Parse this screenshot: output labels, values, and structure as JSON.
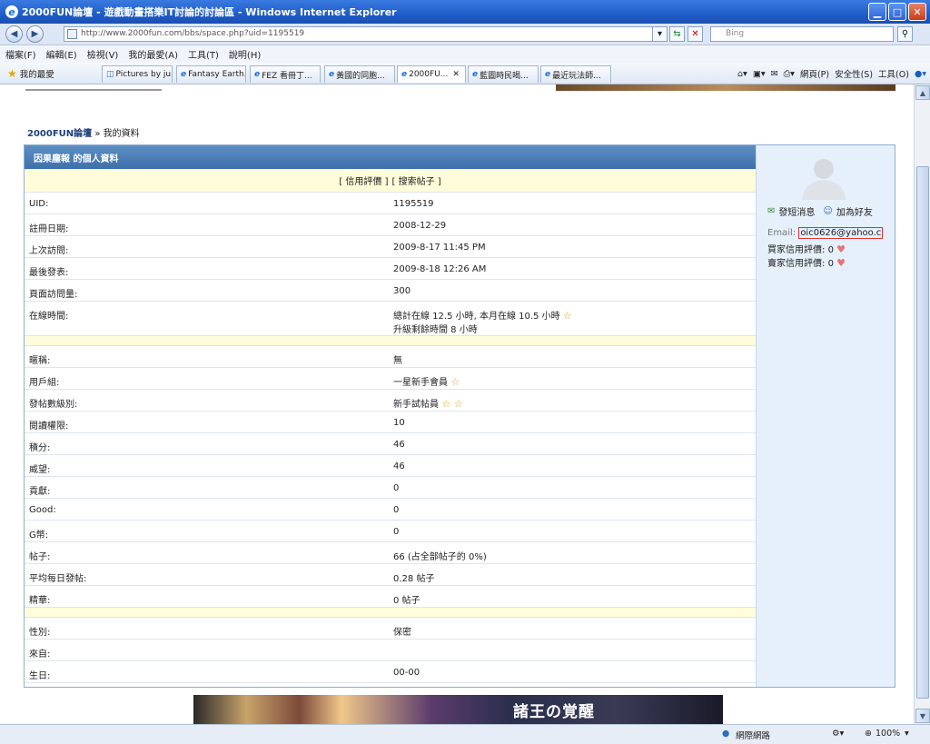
{
  "window": {
    "title": "2000FUN論壇 - 遊戲動畫搭樂IT討論的討論區 - Windows Internet Explorer"
  },
  "address": {
    "url": "http://www.2000fun.com/bbs/space.php?uid=1195519",
    "search_placeholder": "Bing"
  },
  "menu": [
    "檔案(F)",
    "編輯(E)",
    "檢視(V)",
    "我的最愛(A)",
    "工具(T)",
    "說明(H)"
  ],
  "favorites": {
    "label": "我的最愛"
  },
  "tabs": [
    "Pictures by ju...",
    "Fantasy Earth...",
    "FEZ 看冊丁...",
    "黃國的同胞...",
    "2000FU...",
    "藍圖時民喝...",
    "最近玩法師..."
  ],
  "cmd": {
    "page": "網頁(P)",
    "safety": "安全性(S)",
    "tools": "工具(O)"
  },
  "breadcrumb": {
    "site": "2000FUN論壇",
    "sep": "»",
    "page": "我的資料"
  },
  "panel": {
    "title": "因果塵報 的個人資料",
    "links": [
      "[ 信用評價 ]",
      "[ 搜索帖子 ]"
    ],
    "rows1": [
      {
        "k": "UID:",
        "v": "1195519"
      },
      {
        "k": "註冊日期:",
        "v": "2008-12-29"
      },
      {
        "k": "上次訪問:",
        "v": "2009-8-17 11:45 PM"
      },
      {
        "k": "最後發表:",
        "v": "2009-8-18 12:26 AM"
      },
      {
        "k": "頁面訪問量:",
        "v": "300"
      }
    ],
    "online": {
      "k": "在線時間:",
      "v1": "總計在線 12.5 小時, 本月在線 10.5 小時",
      "v2": "升級剩餘時間 8 小時"
    },
    "rows2": [
      {
        "k": "暱稱:",
        "v": "無"
      },
      {
        "k": "用戶組:",
        "v": "一星新手會員"
      },
      {
        "k": "發帖數級別:",
        "v": "新手試帖員"
      },
      {
        "k": "閱讀權限:",
        "v": "10"
      },
      {
        "k": "積分:",
        "v": "46"
      },
      {
        "k": "威望:",
        "v": "46"
      },
      {
        "k": "貢獻:",
        "v": "0"
      },
      {
        "k": "Good:",
        "v": "0"
      },
      {
        "k": "G幣:",
        "v": "0"
      },
      {
        "k": "帖子:",
        "v": "66 (占全部帖子的 0%)"
      },
      {
        "k": "平均每日發帖:",
        "v": "0.28 帖子"
      },
      {
        "k": "精華:",
        "v": "0 帖子"
      }
    ],
    "rows3": [
      {
        "k": "性別:",
        "v": "保密"
      },
      {
        "k": "來自:",
        "v": ""
      },
      {
        "k": "生日:",
        "v": "00-00"
      }
    ]
  },
  "side": {
    "pm": "發短消息",
    "friend": "加為好友",
    "email_label": "Email:",
    "email": "oic0626@yahoo.c",
    "buyer": "買家信用評價:",
    "buyer_val": "0",
    "seller": "賣家信用評價:",
    "seller_val": "0"
  },
  "ad": {
    "text": "諸王の覚醒"
  },
  "status": {
    "zone": "網際網路",
    "zoom": "100%"
  }
}
